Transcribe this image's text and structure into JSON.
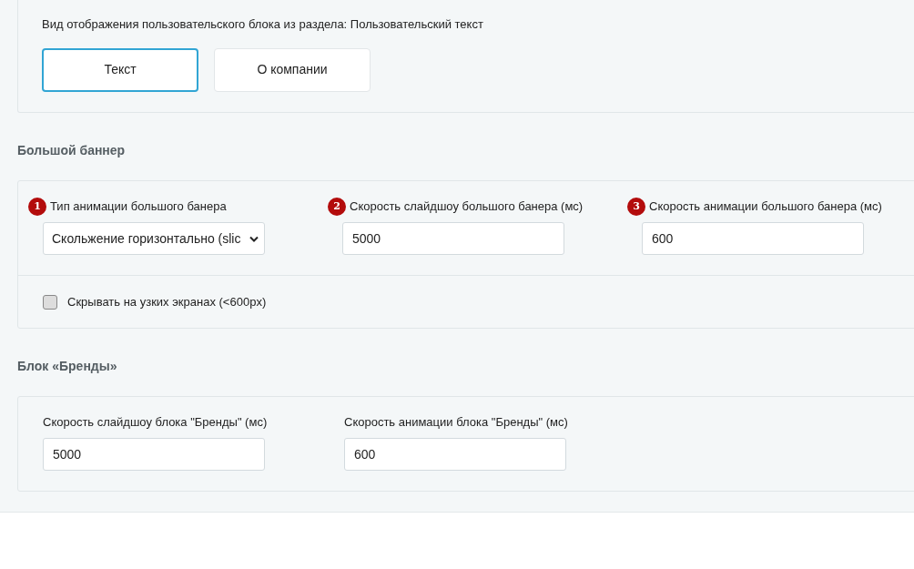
{
  "display_block": {
    "label": "Вид отображения пользовательского блока из раздела: Пользовательский текст",
    "options": [
      {
        "label": "Текст",
        "selected": true
      },
      {
        "label": "О компании",
        "selected": false
      }
    ]
  },
  "big_banner": {
    "heading": "Большой баннер",
    "fields": [
      {
        "kind": "select",
        "badge": "1",
        "label": "Тип анимации большого банера",
        "value": "Скольжение горизонтально (slic"
      },
      {
        "kind": "input",
        "badge": "2",
        "label": "Скорость слайдшоу большого банера (мс)",
        "value": "5000"
      },
      {
        "kind": "input",
        "badge": "3",
        "label": "Скорость анимации большого банера (мс)",
        "value": "600"
      }
    ],
    "hide_on_narrow": {
      "label": "Скрывать на узких экранах (<600px)",
      "checked": false
    }
  },
  "brands_block": {
    "heading": "Блок «Бренды»",
    "fields": [
      {
        "kind": "input",
        "label": "Скорость слайдшоу блока \"Бренды\" (мс)",
        "value": "5000"
      },
      {
        "kind": "input",
        "label": "Скорость анимации блока \"Бренды\" (мс)",
        "value": "600"
      }
    ]
  }
}
